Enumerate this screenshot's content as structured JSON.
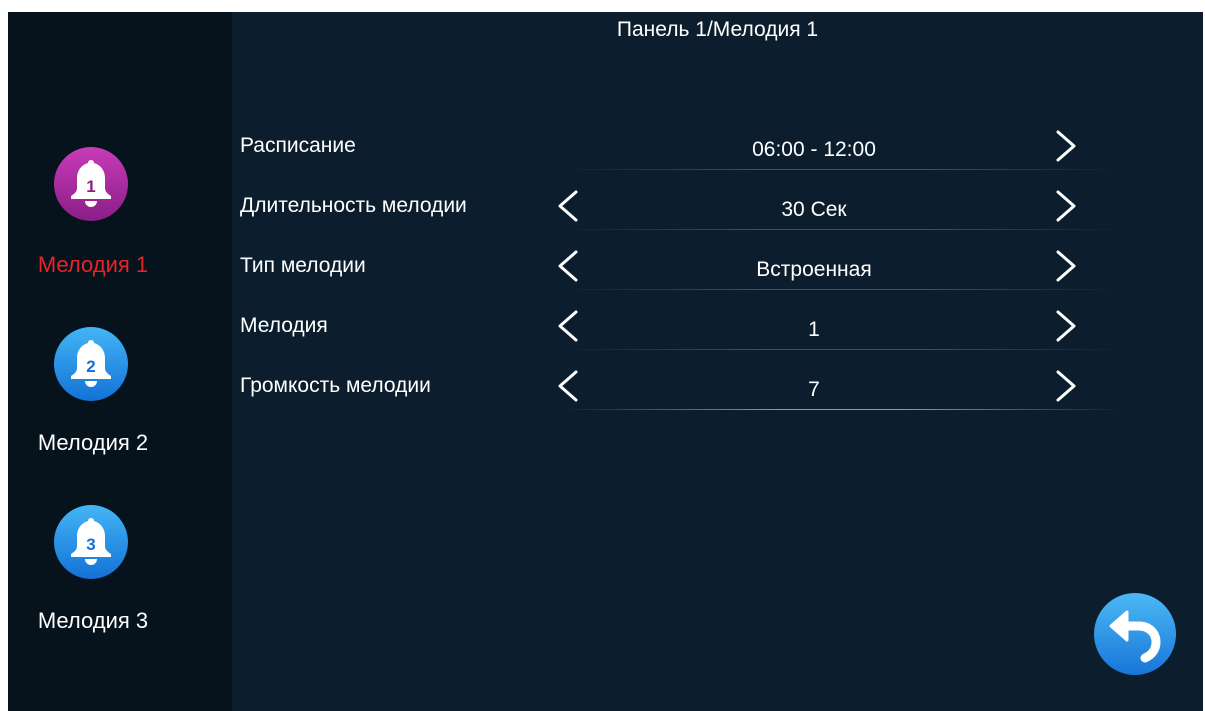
{
  "title": "Панель  1/Мелодия 1",
  "sidebar": {
    "items": [
      {
        "label": "Мелодия 1",
        "number": "1",
        "icon": "bell-1-icon",
        "active": true
      },
      {
        "label": "Мелодия 2",
        "number": "2",
        "icon": "bell-2-icon",
        "active": false
      },
      {
        "label": "Мелодия 3",
        "number": "3",
        "icon": "bell-3-icon",
        "active": false
      }
    ]
  },
  "settings": [
    {
      "label": "Расписание",
      "value": "06:00 - 12:00"
    },
    {
      "label": "Длительность мелодии",
      "value": "30 Сек"
    },
    {
      "label": "Тип мелодии",
      "value": "Встроенная"
    },
    {
      "label": "Мелодия",
      "value": "1"
    },
    {
      "label": "Громкость мелодии",
      "value": "7"
    }
  ],
  "icons": {
    "prev": "chevron-left-icon",
    "next": "chevron-right-icon",
    "back": "back-arrow-icon"
  },
  "colors": {
    "background": "#0c1e2e",
    "sidebar": "#06121c",
    "active_label": "#e8232a",
    "bell_active": "#a7289b",
    "bell_inactive": "#1e8fe6"
  }
}
